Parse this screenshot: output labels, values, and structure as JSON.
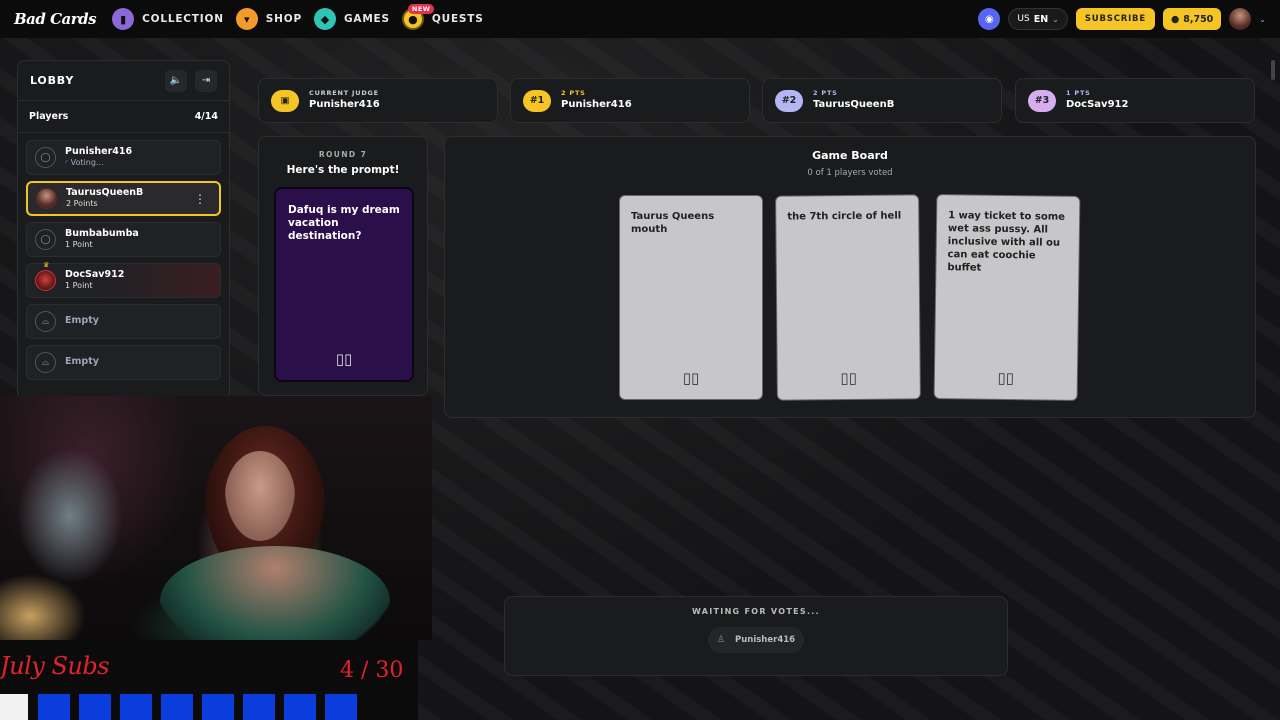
{
  "nav": {
    "logo": "Bad Cards",
    "items": [
      {
        "label": "COLLECTION",
        "icon": "collection-icon",
        "color": "#8b6ad8"
      },
      {
        "label": "SHOP",
        "icon": "shop-icon",
        "color": "#f29a2a"
      },
      {
        "label": "GAMES",
        "icon": "games-icon",
        "color": "#2ec5b5"
      },
      {
        "label": "QUESTS",
        "icon": "quests-icon",
        "color": "#f4c524"
      }
    ],
    "new_badge": "NEW",
    "lang_country": "US",
    "lang_code": "EN",
    "subscribe": "SUBSCRIBE",
    "coins": "8,750"
  },
  "lobby": {
    "title": "LOBBY",
    "players_label": "Players",
    "players_count": "4/14",
    "players": [
      {
        "name": "Punisher416",
        "status": "Voting..."
      },
      {
        "name": "TaurusQueenB",
        "status": "2 Points"
      },
      {
        "name": "Bumbabumba",
        "status": "1 Point"
      },
      {
        "name": "DocSav912",
        "status": "1 Point"
      },
      {
        "name": "Empty"
      },
      {
        "name": "Empty"
      }
    ]
  },
  "stats": [
    {
      "key": "CURRENT JUDGE",
      "value": "Punisher416",
      "badge": ""
    },
    {
      "key": "2 PTS",
      "value": "Punisher416",
      "badge": "#1"
    },
    {
      "key": "2 PTS",
      "value": "TaurusQueenB",
      "badge": "#2"
    },
    {
      "key": "1 PTS",
      "value": "DocSav912",
      "badge": "#3"
    }
  ],
  "round": {
    "label": "ROUND 7",
    "heading": "Here's the prompt!",
    "prompt": "Dafuq is my dream vacation destination?"
  },
  "board": {
    "title": "Game Board",
    "subtitle": "0 of 1 players voted",
    "cards": [
      "Taurus Queens mouth",
      "the 7th circle of hell",
      "1 way ticket to some wet ass pussy. All inclusive with all ou can eat coochie buffet"
    ]
  },
  "waiting": {
    "label": "WAITING FOR VOTES...",
    "player": "Punisher416"
  },
  "overlay": {
    "sub_goal": "July Subs",
    "sub_count": "4 / 30"
  }
}
